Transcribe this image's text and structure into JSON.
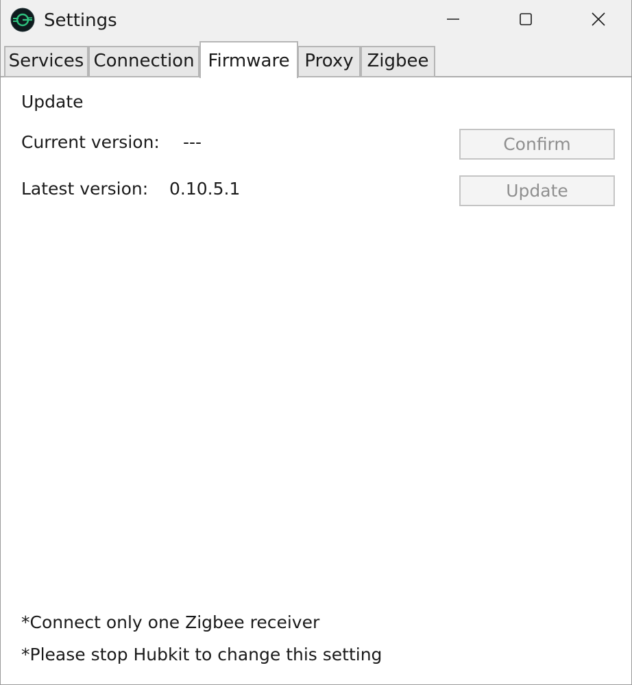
{
  "window": {
    "title": "Settings",
    "icon": "hubkit-logo-icon"
  },
  "tabs": [
    {
      "label": "Services",
      "active": false
    },
    {
      "label": "Connection",
      "active": false
    },
    {
      "label": "Firmware",
      "active": true
    },
    {
      "label": "Proxy",
      "active": false
    },
    {
      "label": "Zigbee",
      "active": false
    }
  ],
  "firmware": {
    "section_title": "Update",
    "current_version_label": "Current version:",
    "current_version_value": "---",
    "latest_version_label": "Latest version:",
    "latest_version_value": "0.10.5.1",
    "confirm_label": "Confirm",
    "update_label": "Update"
  },
  "notes": [
    "*Connect only one Zigbee receiver",
    "*Please stop Hubkit to change this setting"
  ],
  "colors": {
    "titlebar_bg": "#f0f0f0",
    "tab_bg": "#e7e7e7",
    "disabled_text": "#8f8f8f",
    "icon_accent": "#2ec27e"
  }
}
